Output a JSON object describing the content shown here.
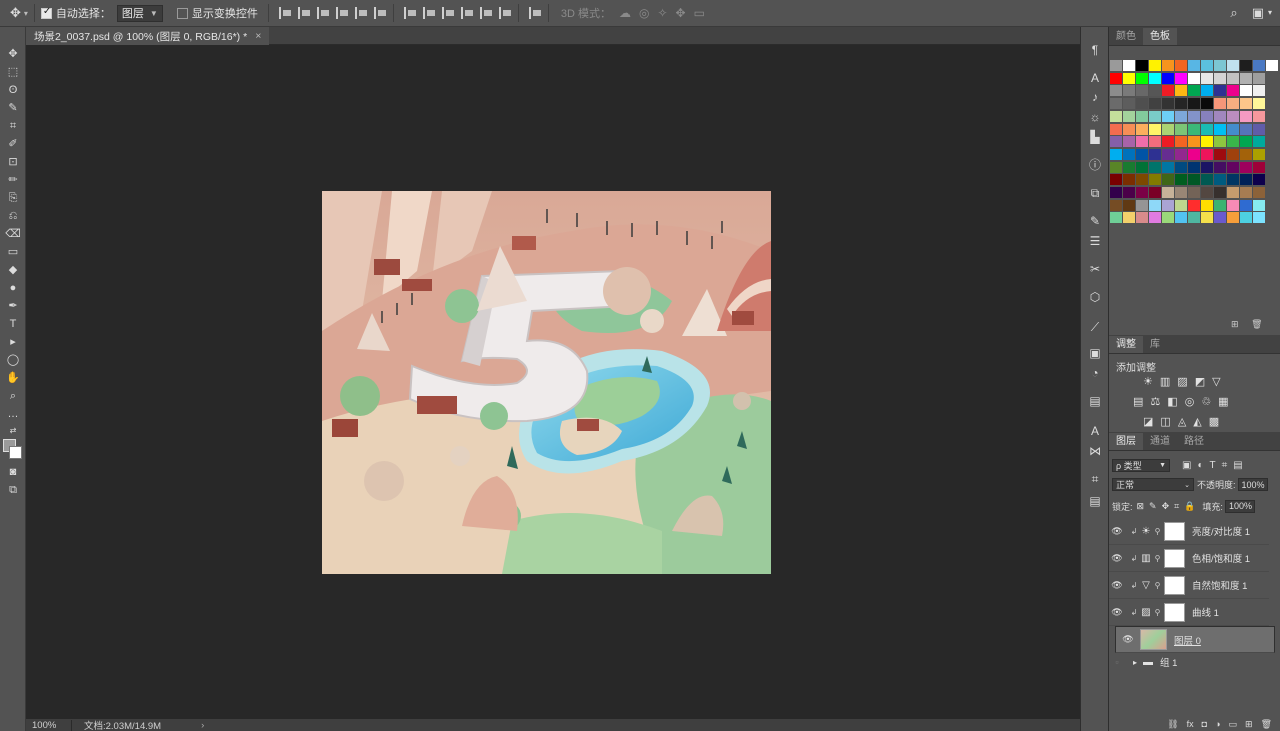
{
  "options_bar": {
    "auto_select_label": "自动选择：",
    "auto_select_target": "图层",
    "show_transform_label": "显示变换控件",
    "mode_3d_label": "3D 模式："
  },
  "document": {
    "tab_title": "场景2_0037.psd @ 100% (图层 0, RGB/16*) *",
    "close": "×"
  },
  "status": {
    "zoom": "100%",
    "doc_info": "文档:2.03M/14.9M",
    "arrow": "›"
  },
  "color_panel": {
    "tabs": [
      "颜色",
      "色板"
    ],
    "active_tab": "色板",
    "swatch_rows": [
      [
        "#9a9a9a",
        "#ffffff",
        "#000000",
        "#fff200",
        "#f7941d",
        "#f26522",
        "#58b6e4",
        "#5bc0de",
        "#7cc6d3",
        "#c0e1ef",
        "#1e1e1e",
        "#4a79c3",
        "#ffffff"
      ],
      [
        "#ff0000",
        "#ffff00",
        "#00ff00",
        "#00ffff",
        "#0000ff",
        "#ff00ff",
        "#ffffff",
        "#e6e6e6",
        "#d4d4d4",
        "#c2c2c2",
        "#b0b0b0",
        "#9e9e9e"
      ],
      [
        "#8c8c8c",
        "#7a7a7a",
        "#686868",
        "#565656",
        "#ee1c25",
        "#fdb813",
        "#00a651",
        "#00aeef",
        "#2e3192",
        "#ec008c",
        "#fff",
        "#f0f0f0"
      ],
      [
        "#6b6b6b",
        "#5d5d5d",
        "#4f4f4f",
        "#414141",
        "#333333",
        "#252525",
        "#171717",
        "#0a0a0a",
        "#f69679",
        "#f9ad81",
        "#fdc68a",
        "#fff799"
      ],
      [
        "#c4df9b",
        "#a3d39c",
        "#82ca9c",
        "#7accc8",
        "#6dcff6",
        "#7da7d9",
        "#8393ca",
        "#8781bd",
        "#a187be",
        "#bc8dbf",
        "#f49ac2",
        "#f6989d"
      ],
      [
        "#f26c4f",
        "#f68e56",
        "#fbaf5d",
        "#fff568",
        "#acd373",
        "#7cc576",
        "#3bb878",
        "#1abbb4",
        "#00bff3",
        "#448ccb",
        "#5574b9",
        "#605ca8"
      ],
      [
        "#855fa8",
        "#a863a8",
        "#f06eaa",
        "#f26d7d",
        "#ed1c24",
        "#f26522",
        "#f7941d",
        "#fff200",
        "#8dc63f",
        "#39b54a",
        "#00a651",
        "#00a99d"
      ],
      [
        "#00aeef",
        "#0072bc",
        "#0054a6",
        "#2e3192",
        "#662d91",
        "#92278f",
        "#ec008c",
        "#ed145b",
        "#9e0b0f",
        "#a0410d",
        "#a3620a",
        "#aba000"
      ],
      [
        "#598527",
        "#197b30",
        "#007236",
        "#00746b",
        "#0076a3",
        "#004a80",
        "#003471",
        "#1b1464",
        "#440e62",
        "#630460",
        "#9e005d",
        "#9e0039"
      ],
      [
        "#790000",
        "#7b2e00",
        "#7d4900",
        "#827b00",
        "#406618",
        "#005e20",
        "#005826",
        "#005952",
        "#005b7f",
        "#003663",
        "#002157",
        "#0d004c"
      ],
      [
        "#32004b",
        "#4b0049",
        "#7b0046",
        "#7a0026",
        "#c7b299",
        "#998675",
        "#736357",
        "#534741",
        "#37302d",
        "#c69c6d",
        "#a67c52",
        "#8c6239"
      ],
      [
        "#754c24",
        "#603913",
        "#959595",
        "#8ed8f8",
        "#aaa4d4",
        "#bed78e",
        "#ff2d2d",
        "#ffde00",
        "#3cb371",
        "#f78bb5",
        "#2f6bd1",
        "#86eaf0"
      ],
      [
        "#6fcf97",
        "#f2d06b",
        "#d88b8b",
        "#e07be0",
        "#9ad97a",
        "#52c3f1",
        "#4fb7a1",
        "#f5e04b",
        "#6a5acd",
        "#f79e3a",
        "#4dd0e1",
        "#7ce3ff"
      ]
    ]
  },
  "adjustments_panel": {
    "tabs": [
      "调整",
      "库"
    ],
    "active_tab": "调整",
    "title": "添加调整",
    "row1": [
      "☀",
      "▥",
      "▨",
      "◩",
      "▽"
    ],
    "row2": [
      "▤",
      "⚖",
      "◧",
      "◎",
      "♲",
      "▦"
    ],
    "row3": [
      "◪",
      "◫",
      "◬",
      "◭",
      "▩"
    ]
  },
  "layers_panel": {
    "tabs": [
      "图层",
      "通道",
      "路径"
    ],
    "active_tab": "图层",
    "filter_label": "ρ 类型",
    "blend_mode": "正常",
    "opacity_label": "不透明度:",
    "opacity": "100%",
    "lock_label": "锁定:",
    "fill_label": "填充:",
    "fill": "100%",
    "layers": [
      {
        "name": "亮度/对比度 1",
        "icon": "☀"
      },
      {
        "name": "色相/饱和度 1",
        "icon": "▥"
      },
      {
        "name": "自然饱和度 1",
        "icon": "▽"
      },
      {
        "name": "曲线 1",
        "icon": "▨"
      },
      {
        "name": "图层 0",
        "icon": ""
      },
      {
        "name": "组 1",
        "icon": "▸"
      }
    ],
    "bottom_icons": [
      "⛓",
      "fx",
      "◘",
      "◑",
      "▭",
      "⊞",
      "🗑"
    ]
  },
  "tools": [
    "✥",
    "⬚",
    "ʘ",
    "✎",
    "⌗",
    "✐",
    "⊡",
    "✏",
    "⎘",
    "⎌",
    "⌫",
    "▭",
    "◆",
    "●",
    "✒",
    "T",
    "▸",
    "◯",
    "✋",
    "⌕",
    "…"
  ]
}
